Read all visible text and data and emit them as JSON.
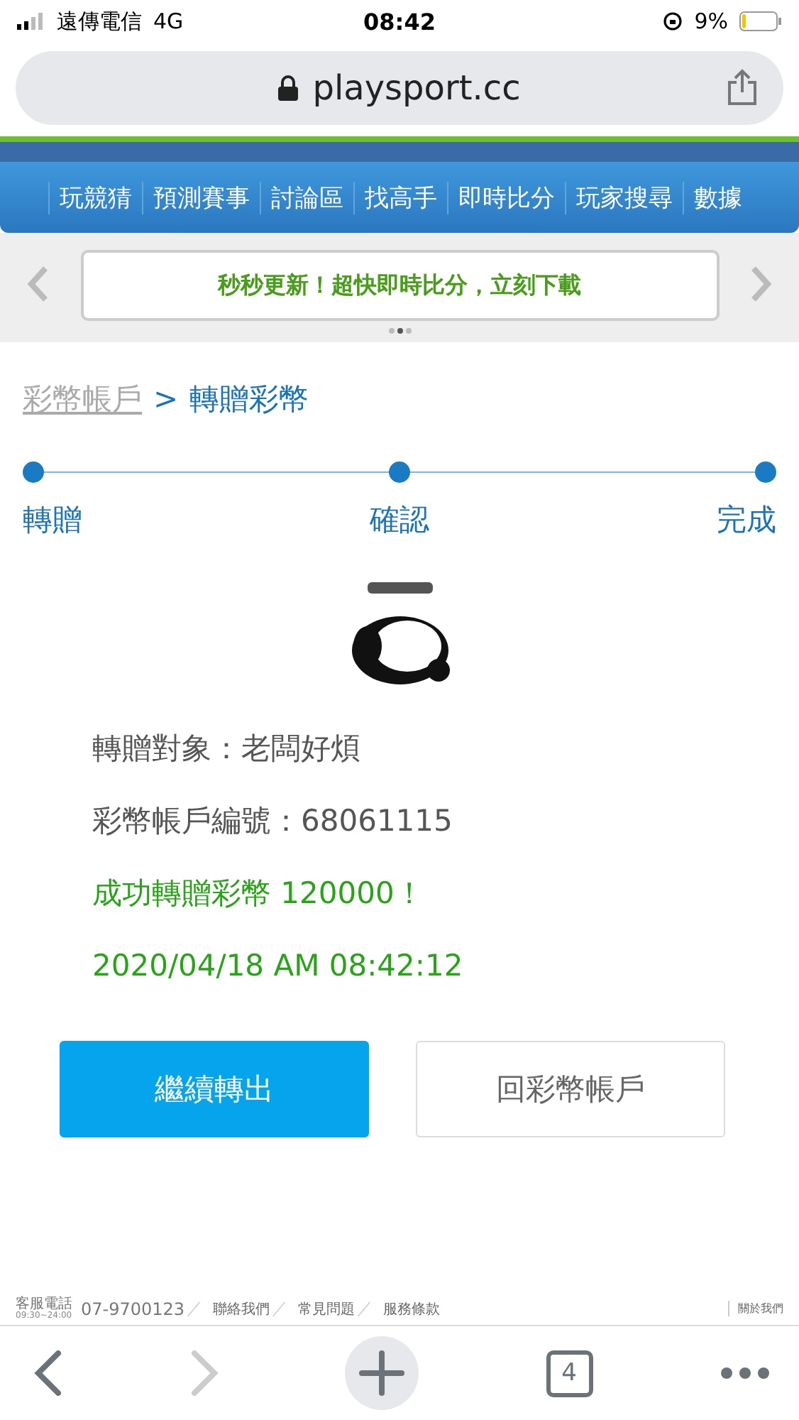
{
  "status_bar": {
    "carrier": "遠傳電信",
    "network": "4G",
    "time": "08:42",
    "battery": "9%"
  },
  "address_bar": {
    "url": "playsport.cc"
  },
  "nav": {
    "items": [
      "玩競猜",
      "預測賽事",
      "討論區",
      "找高手",
      "即時比分",
      "玩家搜尋",
      "數據"
    ]
  },
  "banner": {
    "text": "秒秒更新！超快即時比分，立刻下載",
    "dots": [
      {
        "selected": false
      },
      {
        "selected": true
      },
      {
        "selected": false
      }
    ]
  },
  "breadcrumb": {
    "link": "彩幣帳戶",
    "separator": ">",
    "current": "轉贈彩幣"
  },
  "steps": [
    {
      "label": "轉贈",
      "done": true
    },
    {
      "label": "確認",
      "done": true
    },
    {
      "label": "完成",
      "done": true
    }
  ],
  "details": [
    {
      "kind": "info",
      "text": "轉贈對象：老闆好煩"
    },
    {
      "kind": "info",
      "text": "彩幣帳戶編號：68061115"
    },
    {
      "kind": "success",
      "text": "成功轉贈彩幣 120000！"
    },
    {
      "kind": "success",
      "text": "2020/04/18 AM 08:42:12"
    }
  ],
  "buttons": [
    {
      "kind": "primary",
      "label": "繼續轉出"
    },
    {
      "kind": "secondary",
      "label": "回彩幣帳戶"
    }
  ],
  "footer": {
    "phone_label": "客服電話",
    "hours": "09:30~24:00",
    "phone": "07-9700123",
    "links": [
      "聯絡我們",
      "常見問題",
      "服務條款"
    ],
    "about": "關於我們"
  },
  "toolbar": {
    "back_disabled": false,
    "forward_disabled": true,
    "tab_count": "4"
  }
}
